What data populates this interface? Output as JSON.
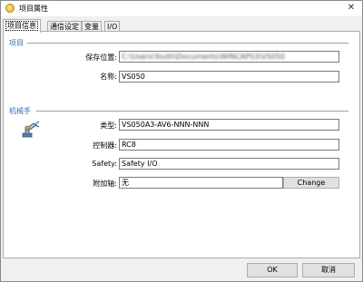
{
  "window": {
    "title": "项目属性",
    "close_glyph": "✕"
  },
  "tabs": [
    {
      "label": "项目信息",
      "active": true
    },
    {
      "label": "通信设定",
      "active": false
    },
    {
      "label": "变量",
      "active": false
    },
    {
      "label": "I/O",
      "active": false
    }
  ],
  "project_section": {
    "title": "项目",
    "save_location_label": "保存位置:",
    "save_location_value": "C:\\Users\\Youth\\Documents\\WINCAPS3\\VS050",
    "name_label": "名称:",
    "name_value": "VS050"
  },
  "robot_section": {
    "title": "机械手",
    "type_label": "类型:",
    "type_value": "VS050A3-AV6-NNN-NNN",
    "controller_label": "控制器:",
    "controller_value": "RC8",
    "safety_label": "Safety:",
    "safety_value": "Safety I/O",
    "extra_axis_label": "附加轴:",
    "extra_axis_value": "无",
    "change_label": "Change"
  },
  "buttons": {
    "ok": "OK",
    "cancel": "取消"
  },
  "colors": {
    "section_title": "#2d6fbf",
    "panel_bg": "#ffffff",
    "window_bg": "#f0f0f0"
  },
  "icons": {
    "app": "project-icon",
    "robot": "robot-arm-icon",
    "close": "close-icon"
  }
}
